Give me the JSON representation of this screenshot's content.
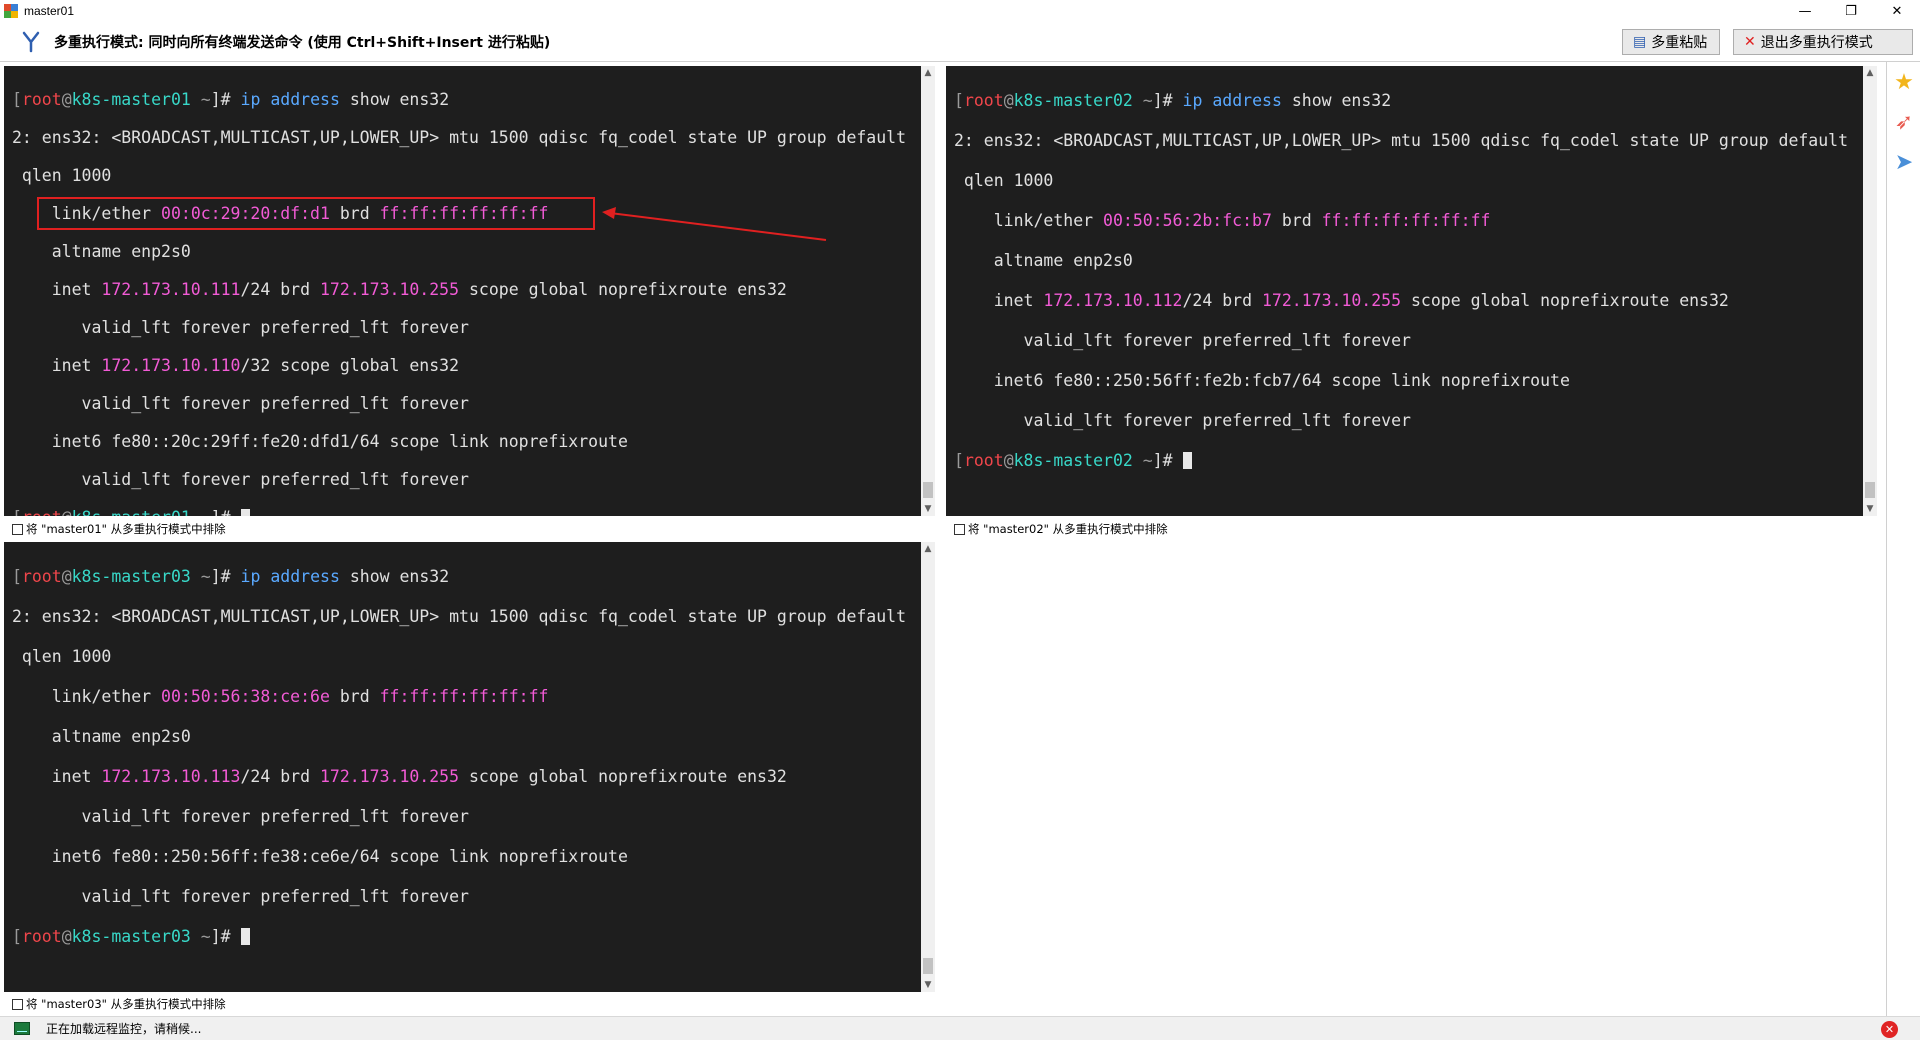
{
  "window": {
    "title": "master01",
    "minimize": "—",
    "restore": "❐",
    "close": "✕"
  },
  "toolbar": {
    "mode_text": "多重执行模式: 同时向所有终端发送命令 (使用 Ctrl+Shift+Insert 进行粘贴)",
    "paste_label": "多重粘贴",
    "exit_label": "退出多重执行模式"
  },
  "panes": [
    {
      "host": "k8s-master01",
      "exclude_label": "将 \"master01\" 从多重执行模式中排除",
      "mac": "00:0c:29:20:df:d1",
      "brd_mac": "ff:ff:ff:ff:ff:ff",
      "inet": "172.173.10.111",
      "brd": "172.173.10.255",
      "vip": "172.173.10.110",
      "inet6": "fe80::20c:29ff:fe20:dfd1/64"
    },
    {
      "host": "k8s-master02",
      "exclude_label": "将 \"master02\" 从多重执行模式中排除",
      "mac": "00:50:56:2b:fc:b7",
      "brd_mac": "ff:ff:ff:ff:ff:ff",
      "inet": "172.173.10.112",
      "brd": "172.173.10.255",
      "inet6": "fe80::250:56ff:fe2b:fcb7/64"
    },
    {
      "host": "k8s-master03",
      "exclude_label": "将 \"master03\" 从多重执行模式中排除",
      "mac": "00:50:56:38:ce:6e",
      "brd_mac": "ff:ff:ff:ff:ff:ff",
      "inet": "172.173.10.113",
      "brd": "172.173.10.255",
      "inet6": "fe80::250:56ff:fe38:ce6e/64"
    }
  ],
  "terminal": {
    "user": "root",
    "at": "@",
    "home": "~",
    "cmd_ip": "ip",
    "cmd_address": "address",
    "cmd_rest": "show ens32",
    "iface_line": "2: ens32: <BROADCAST,MULTICAST,UP,LOWER_UP> mtu 1500 qdisc fq_codel state UP group default",
    "qlen_line": " qlen 1000",
    "link_prefix": "    link/ether ",
    "brd_word": " brd ",
    "altname_line": "    altname enp2s0",
    "inet_prefix": "    inet ",
    "inet_mid": "/24 brd ",
    "inet_suffix": " scope global noprefixroute ens32",
    "valid_line": "       valid_lft forever preferred_lft forever",
    "vip_prefix": "    inet ",
    "vip_suffix": "/32 scope global ens32",
    "inet6_prefix": "    inet6 ",
    "inet6_suffix": " scope link noprefixroute"
  },
  "status": {
    "text": "正在加载远程监控，请稍候...",
    "error_icon": "✕"
  },
  "colors": {
    "terminal_bg": "#1e1e1e",
    "prompt_user": "#f0464b",
    "prompt_host": "#38d8c8",
    "command": "#5aa9ff",
    "address": "#f25bd6",
    "highlight": "#e02020"
  },
  "icons": [
    "multi-exec-icon",
    "paste-icon",
    "close-red-icon",
    "star-icon",
    "rocket-icon",
    "send-icon",
    "monitor-icon",
    "error-icon"
  ]
}
